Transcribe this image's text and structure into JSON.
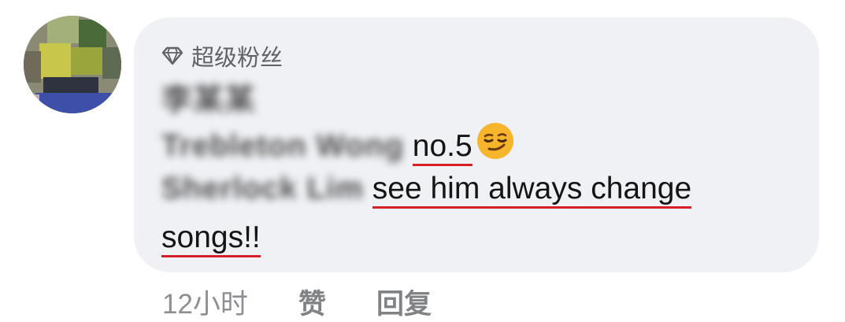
{
  "badge": {
    "icon": "diamond-icon",
    "label": "超级粉丝"
  },
  "comment": {
    "author_blurred": "李某某",
    "mention1_blurred": "Trebleton Wong",
    "mention1_text": "no.5",
    "emoji": "smirking-face-emoji",
    "mention2_blurred": "Sherlock Lim",
    "mention2_text": "see him always change",
    "continuation": "songs!!"
  },
  "footer": {
    "time": "12小时",
    "like_label": "赞",
    "reply_label": "回复"
  },
  "colors": {
    "underline": "#d81f26",
    "bubble_bg": "#f0f1f5",
    "meta_text": "#8d8f94"
  }
}
